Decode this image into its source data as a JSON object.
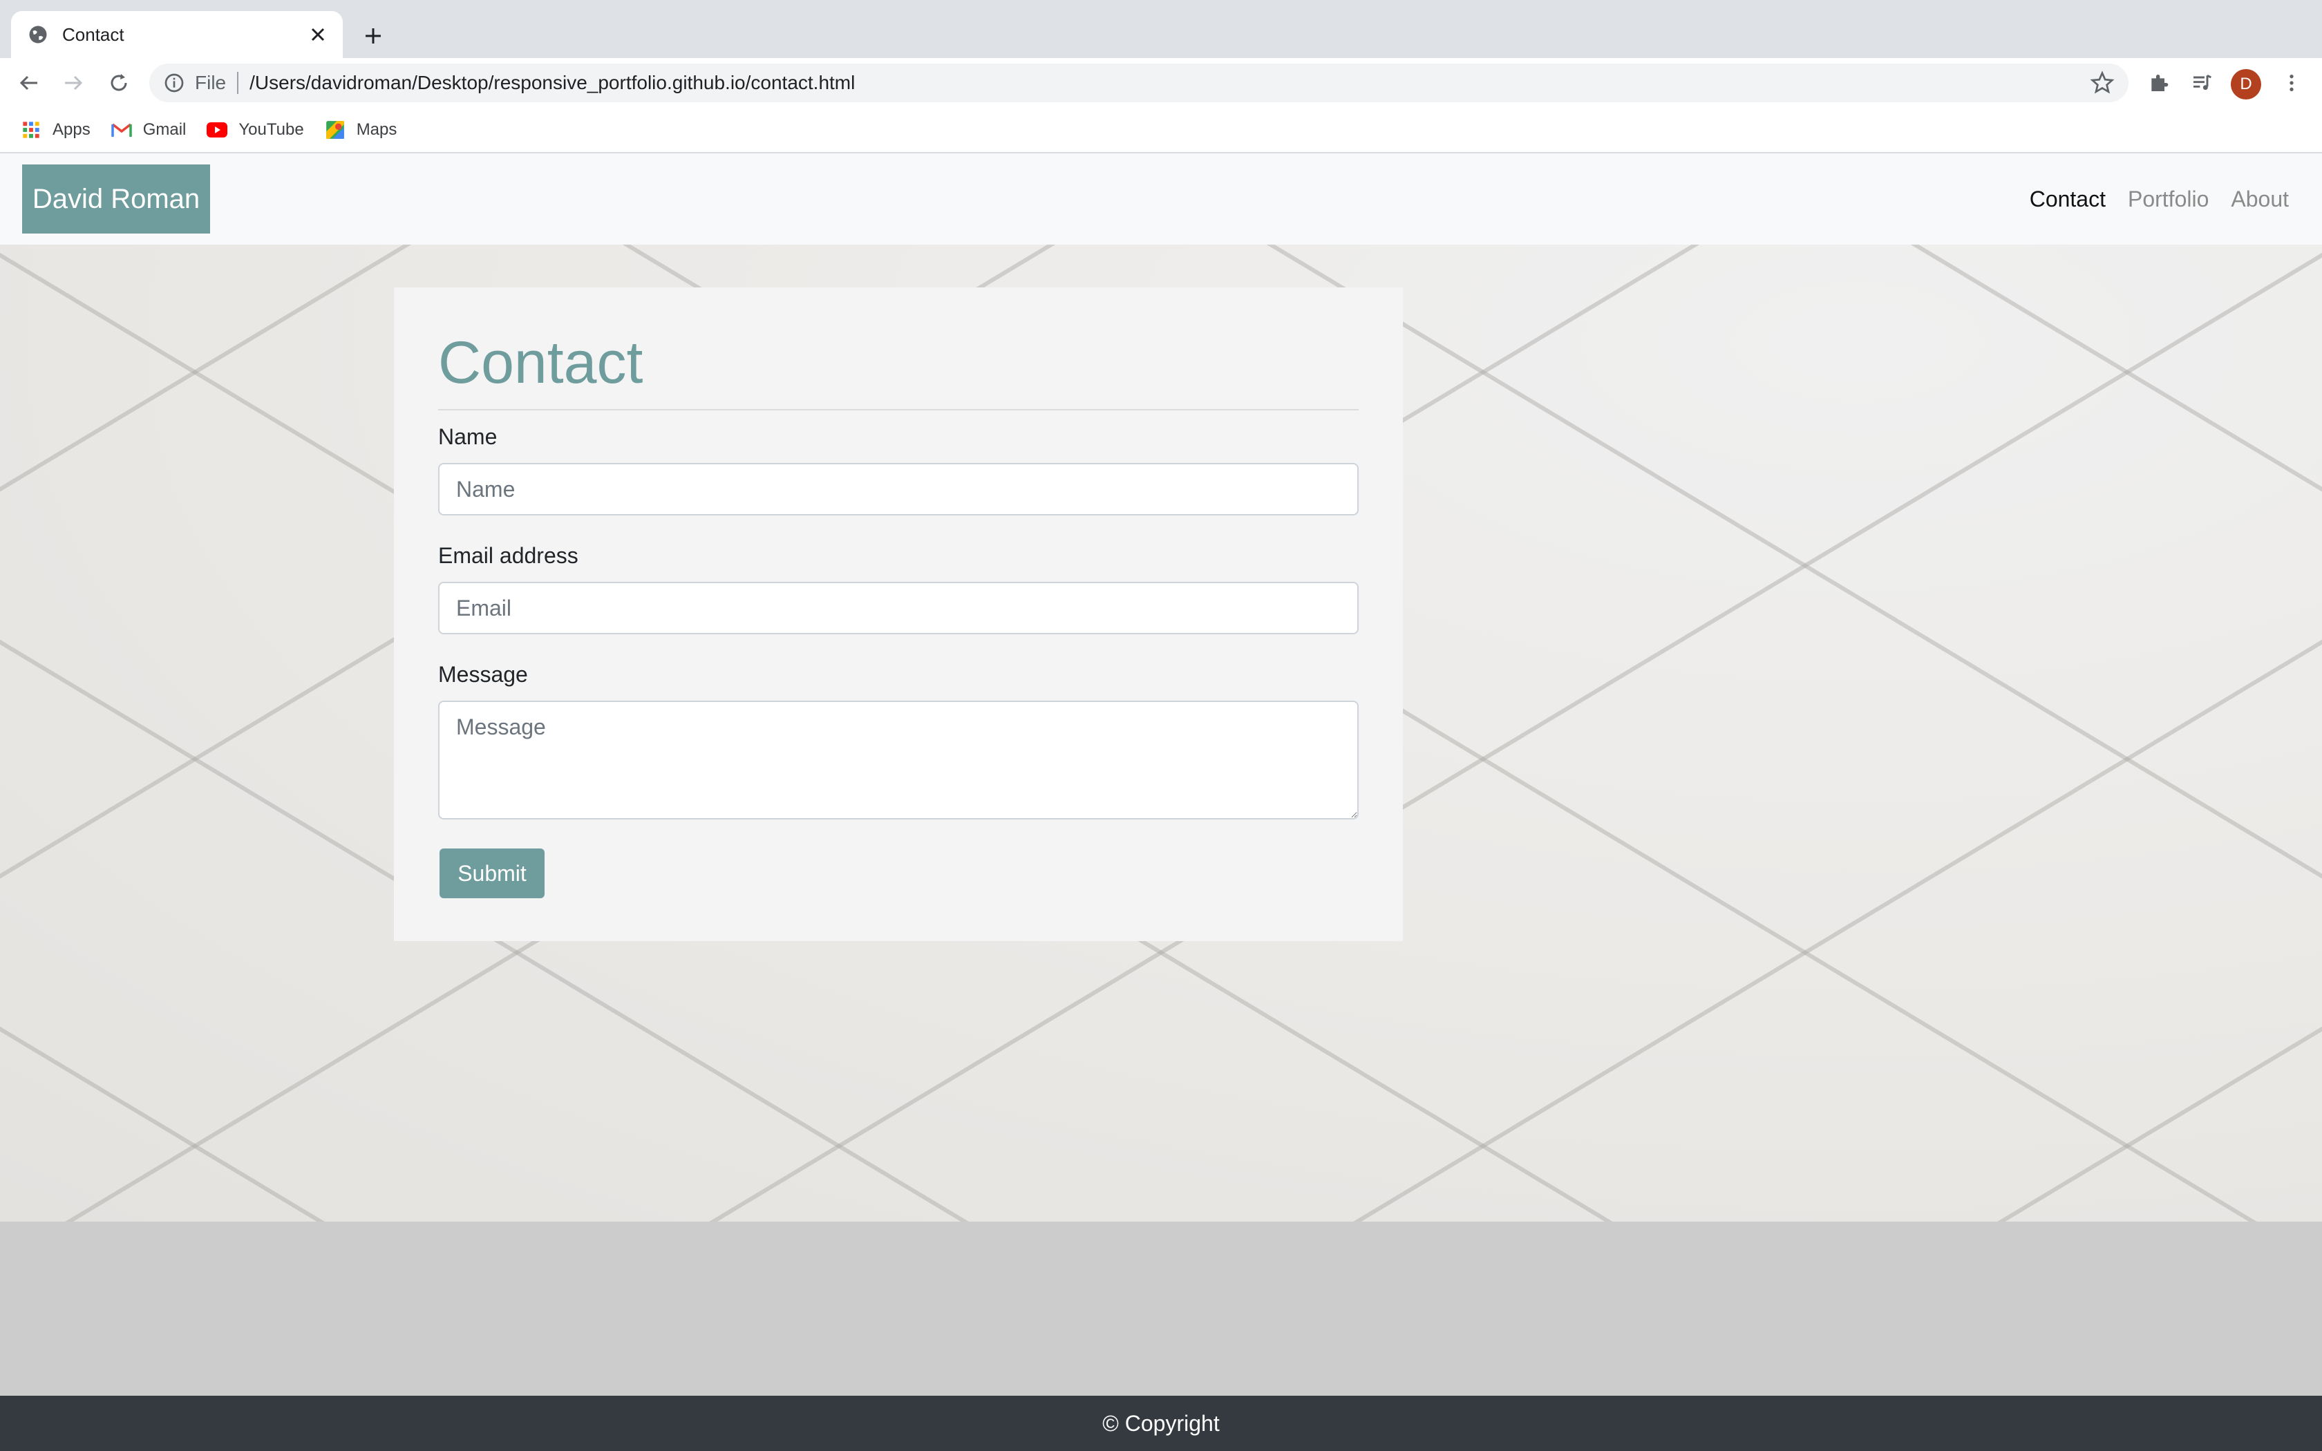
{
  "browser": {
    "tab_title": "Contact",
    "scheme_label": "File",
    "url": "/Users/davidroman/Desktop/responsive_portfolio.github.io/contact.html",
    "profile_initial": "D",
    "bookmarks": [
      {
        "label": "Apps",
        "icon": "apps-grid-icon"
      },
      {
        "label": "Gmail",
        "icon": "gmail-icon"
      },
      {
        "label": "YouTube",
        "icon": "youtube-icon"
      },
      {
        "label": "Maps",
        "icon": "maps-icon"
      }
    ]
  },
  "site": {
    "brand": "David Roman",
    "nav": [
      {
        "label": "Contact",
        "active": true
      },
      {
        "label": "Portfolio",
        "active": false
      },
      {
        "label": "About",
        "active": false
      }
    ]
  },
  "form": {
    "heading": "Contact",
    "name_label": "Name",
    "name_placeholder": "Name",
    "email_label": "Email address",
    "email_placeholder": "Email",
    "message_label": "Message",
    "message_placeholder": "Message",
    "submit_label": "Submit"
  },
  "footer": {
    "copyright": "© Copyright"
  },
  "colors": {
    "accent": "#6f9c9c",
    "footer_bg": "#343a40",
    "avatar_bg": "#b3401f"
  }
}
